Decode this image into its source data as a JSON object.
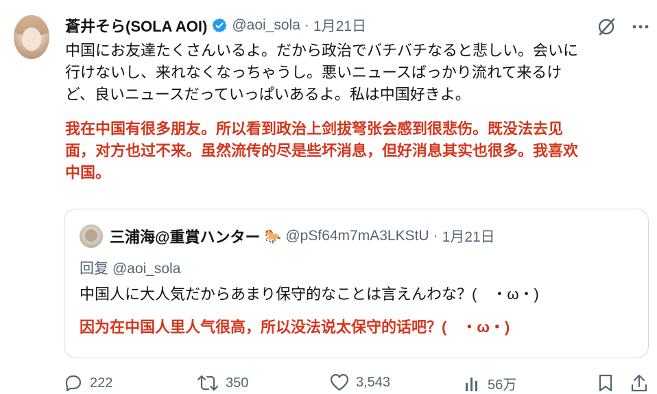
{
  "tweet": {
    "display_name": "蒼井そら(SOLA AOI)",
    "handle": "@aoi_sola",
    "separator": "·",
    "date": "1月21日",
    "text_ja": "中国にお友達たくさんいるよ。だから政治でバチバチなると悲しい。会いに\n行けないし、来れなくなっちゃうし。悪いニュースばっかり流れて来るけ\nど、良いニュースだっていっぱいあるよ。私は中国好きよ。",
    "text_zh": "我在中国有很多朋友。所以看到政治上剑拔弩张会感到很悲伤。既没法去见\n面，对方也过不来。虽然流传的尽是些坏消息，但好消息其实也很多。我喜欢\n中国。"
  },
  "quote": {
    "display_name": "三浦海@重賞ハンター",
    "name_emoji": "🐎",
    "handle": "@pSf64m7mA3LKStU",
    "separator": "·",
    "date": "1月21日",
    "reply_to": "回复 @aoi_sola",
    "text_ja": "中国人に大人気だからあまり保守的なことは言えんわな？(　・ω・)",
    "text_zh": "因为在中国人里人气很高，所以没法说太保守的话吧？(　・ω・)"
  },
  "actions": {
    "replies": "222",
    "retweets": "350",
    "likes": "3,543",
    "views": "56万"
  },
  "icons": {
    "verified": "verified-badge-icon",
    "grok": "grok-icon",
    "more": "more-icon",
    "reply": "reply-icon",
    "retweet": "retweet-icon",
    "like": "like-icon",
    "views": "views-icon",
    "bookmark": "bookmark-icon",
    "share": "share-icon"
  },
  "colors": {
    "verified": "#1d9bf0",
    "translation": "#d4351c",
    "secondary_text": "#536471"
  }
}
